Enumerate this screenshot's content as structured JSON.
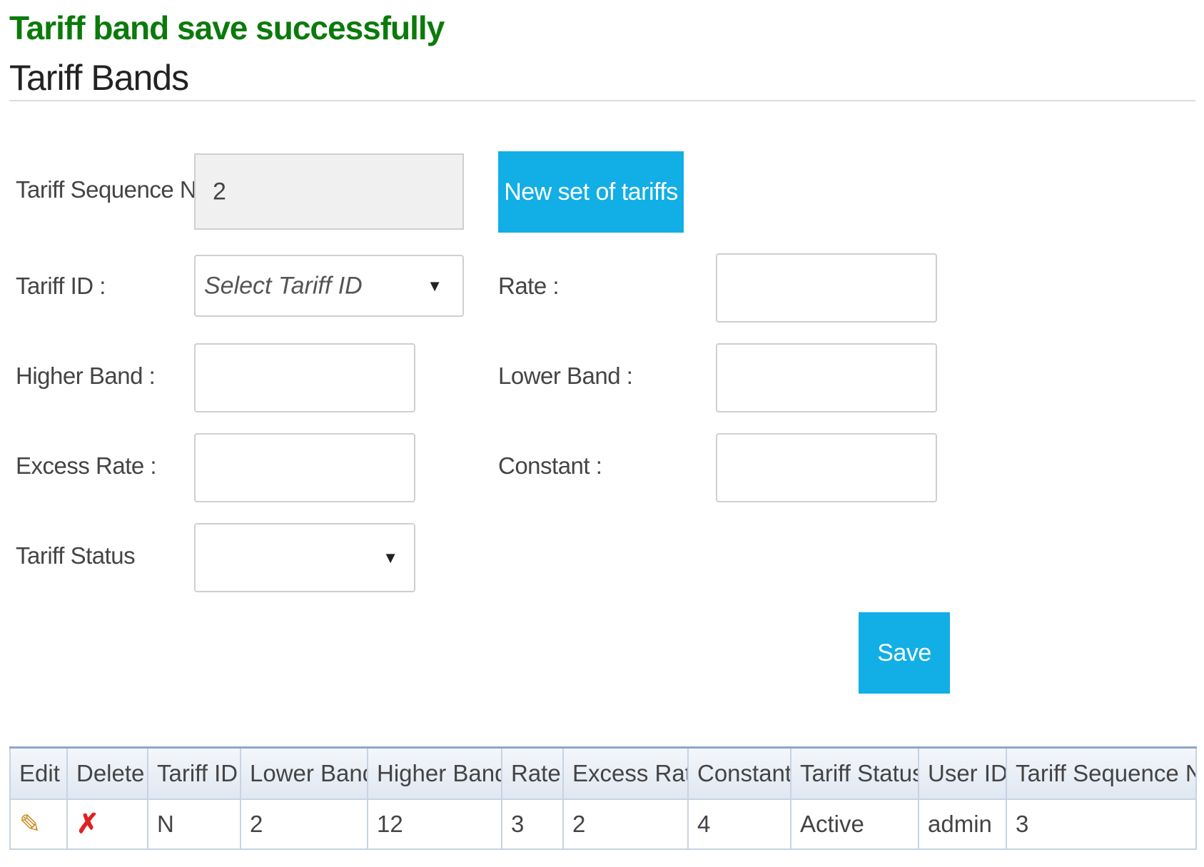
{
  "message": "Tariff band save successfully",
  "page_title": "Tariff Bands",
  "form": {
    "tariff_sequence_no": {
      "label": "Tariff Sequence No",
      "value": "2"
    },
    "new_set_button": "New set of tariffs",
    "tariff_id": {
      "label": "Tariff ID :",
      "placeholder": "Select Tariff ID"
    },
    "rate": {
      "label": "Rate :",
      "value": ""
    },
    "higher_band": {
      "label": "Higher Band :",
      "value": ""
    },
    "lower_band": {
      "label": "Lower Band :",
      "value": ""
    },
    "excess_rate": {
      "label": "Excess Rate :",
      "value": ""
    },
    "constant": {
      "label": "Constant :",
      "value": ""
    },
    "tariff_status": {
      "label": "Tariff Status",
      "value": ""
    },
    "caret": "▼",
    "save_button": "Save"
  },
  "table": {
    "columns": [
      "Edit",
      "Delete",
      "Tariff ID",
      "Lower Band",
      "Higher Band",
      "Rate",
      "Excess Rate",
      "Constant",
      "Tariff Status",
      "User ID",
      "Tariff Sequence No"
    ],
    "rows": [
      {
        "edit_icon": "✎",
        "delete_icon": "✗",
        "tariff_id": "N",
        "lower_band": "2",
        "higher_band": "12",
        "rate": "3",
        "excess_rate": "2",
        "constant": "4",
        "tariff_status": "Active",
        "user_id": "admin",
        "tariff_sequence_no": "3"
      }
    ]
  },
  "icons": {
    "edit": "pencil-icon",
    "delete": "delete-x-icon"
  },
  "colors": {
    "success": "#0b7a0b",
    "accent": "#12aee6",
    "delete": "#e02020"
  }
}
